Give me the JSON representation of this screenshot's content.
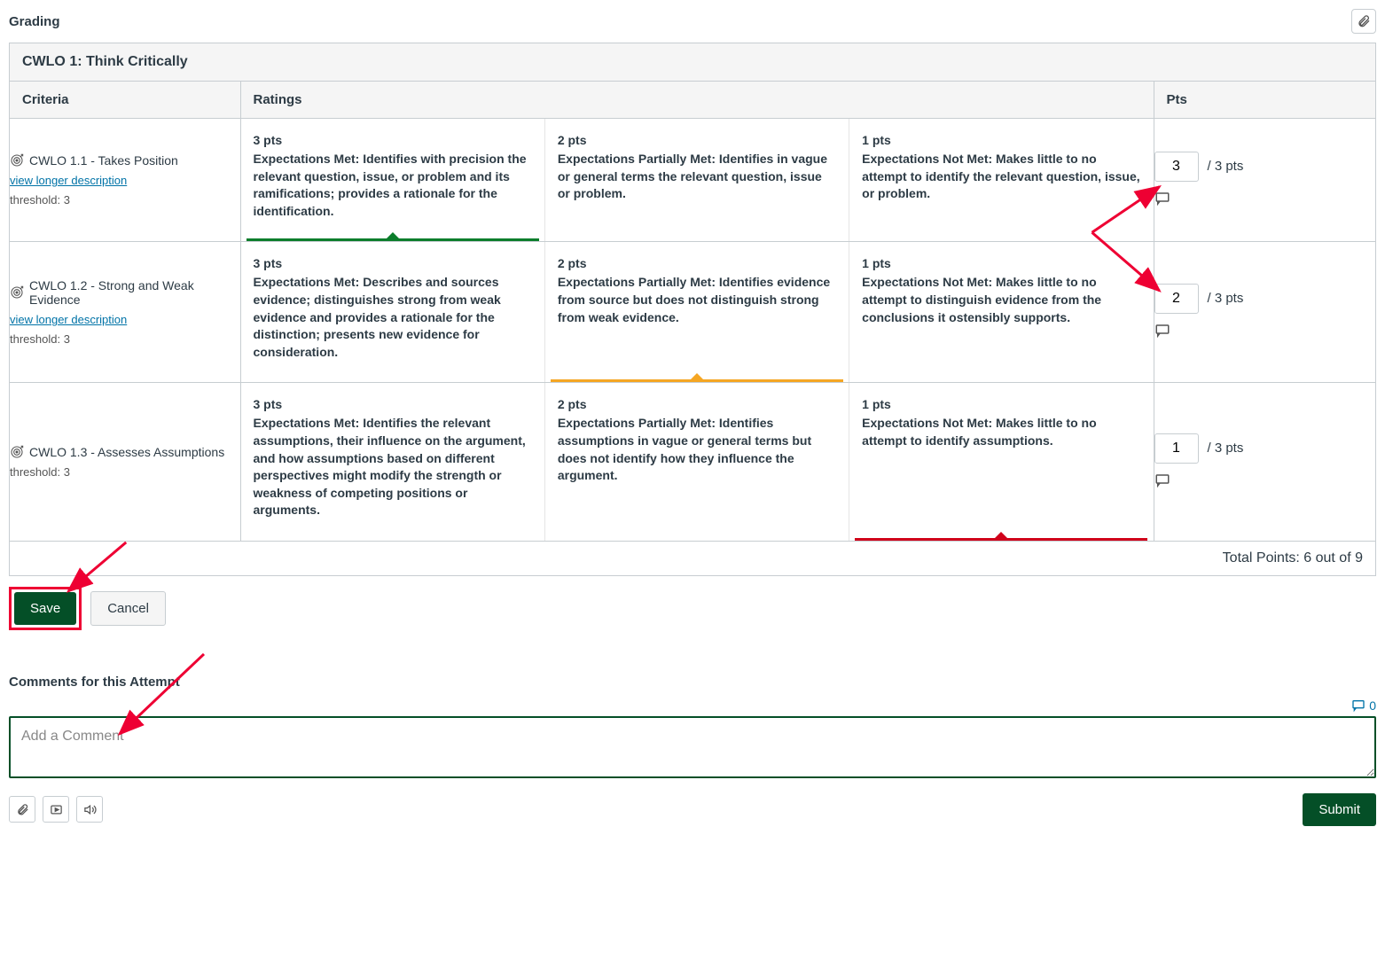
{
  "header": {
    "title": "Grading"
  },
  "rubric": {
    "title": "CWLO 1: Think Critically",
    "columns": {
      "criteria": "Criteria",
      "ratings": "Ratings",
      "pts": "Pts"
    },
    "view_longer_label": "view longer description",
    "rows": [
      {
        "name": "CWLO 1.1 - Takes Position",
        "has_view_longer": true,
        "threshold": "threshold: 3",
        "ratings": [
          {
            "pts": "3 pts",
            "desc": "Expectations Met: Identifies with precision the relevant question, issue, or problem and its ramifications; provides a rationale for the identification.",
            "selected": "green"
          },
          {
            "pts": "2 pts",
            "desc": "Expectations Partially Met: Identifies in vague or general terms the relevant question, issue or problem."
          },
          {
            "pts": "1 pts",
            "desc": "Expectations Not Met: Makes little to no attempt to identify the relevant question, issue, or problem."
          }
        ],
        "score": "3",
        "max": "/ 3 pts"
      },
      {
        "name": "CWLO 1.2 - Strong and Weak Evidence",
        "has_view_longer": true,
        "threshold": "threshold: 3",
        "ratings": [
          {
            "pts": "3 pts",
            "desc": "Expectations Met: Describes and sources evidence; distinguishes strong from weak evidence and provides a rationale for the distinction; presents new evidence for consideration."
          },
          {
            "pts": "2 pts",
            "desc": "Expectations Partially Met: Identifies evidence from source but does not distinguish strong from weak evidence.",
            "selected": "yellow"
          },
          {
            "pts": "1 pts",
            "desc": "Expectations Not Met: Makes little to no attempt to distinguish evidence from the conclusions it ostensibly supports."
          }
        ],
        "score": "2",
        "max": "/ 3 pts"
      },
      {
        "name": "CWLO 1.3 - Assesses Assumptions",
        "has_view_longer": false,
        "threshold": "threshold: 3",
        "ratings": [
          {
            "pts": "3 pts",
            "desc": "Expectations Met: Identifies the relevant assumptions, their influence on the argument, and how assumptions based on different perspectives might modify the strength or weakness of competing positions or arguments."
          },
          {
            "pts": "2 pts",
            "desc": "Expectations Partially Met: Identifies assumptions in vague or general terms but does not identify how they influence the argument."
          },
          {
            "pts": "1 pts",
            "desc": "Expectations Not Met: Makes little to no attempt to identify assumptions.",
            "selected": "red"
          }
        ],
        "score": "1",
        "max": "/ 3 pts"
      }
    ],
    "total": "Total Points: 6 out of 9"
  },
  "buttons": {
    "save": "Save",
    "cancel": "Cancel",
    "submit": "Submit"
  },
  "comments": {
    "title": "Comments for this Attempt",
    "placeholder": "Add a Comment",
    "count": "0"
  }
}
